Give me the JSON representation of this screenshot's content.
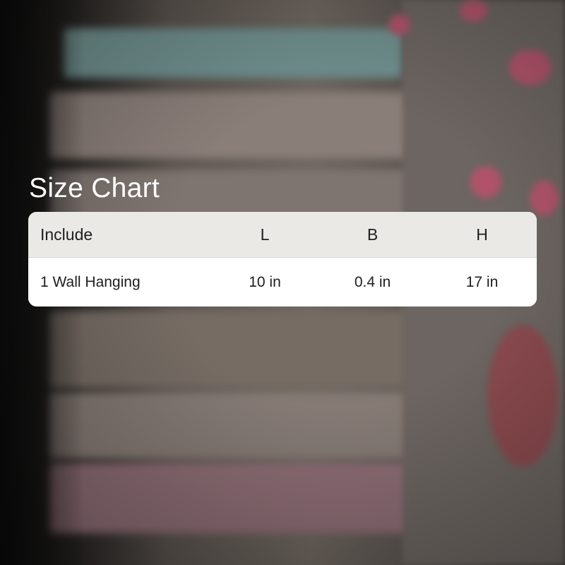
{
  "size_chart": {
    "title": "Size Chart",
    "columns": [
      "Include",
      "L",
      "B",
      "H"
    ],
    "rows": [
      {
        "include": "1 Wall Hanging",
        "l": "10 in",
        "b": "0.4 in",
        "h": "17 in"
      }
    ]
  },
  "colors": {
    "title_text": "#ffffff",
    "header_bg": "#ebe9e6",
    "body_bg": "#ffffff",
    "cell_text": "#1e1e1e"
  }
}
